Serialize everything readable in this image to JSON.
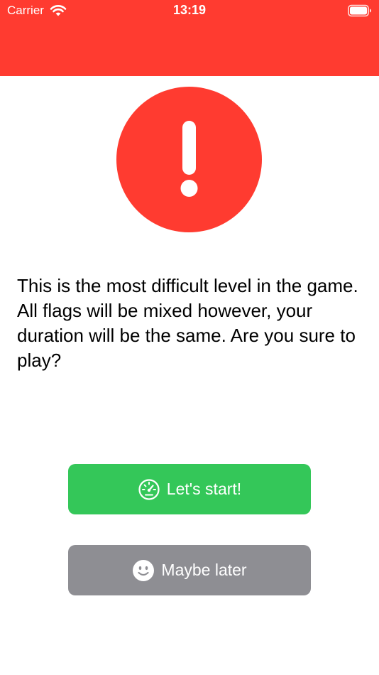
{
  "status_bar": {
    "carrier": "Carrier",
    "time": "13:19",
    "wifi_icon": "wifi-icon",
    "battery_icon": "battery-icon"
  },
  "header": {
    "color": "#FF3B30"
  },
  "alert": {
    "icon": "exclamation-icon",
    "color": "#FF3B30",
    "message": "This is the most difficult level in the game. All flags will be mixed however, your duration will be the same. Are you sure to play?"
  },
  "buttons": {
    "start": {
      "label": "Let's start!",
      "icon": "speedometer-icon",
      "color": "#34C759"
    },
    "later": {
      "label": "Maybe later",
      "icon": "smiley-face-icon",
      "color": "#8E8E93"
    }
  }
}
